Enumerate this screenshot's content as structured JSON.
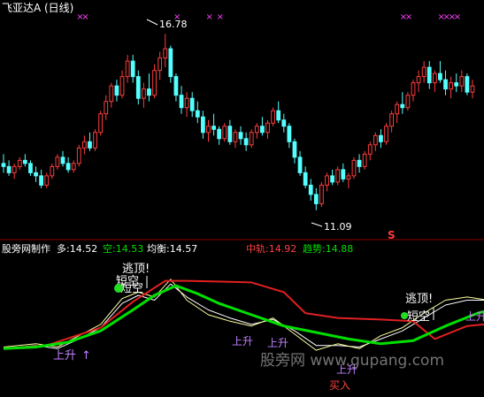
{
  "title_bar": {
    "stock_name": "飞亚达A",
    "period": "(日线)"
  },
  "colors": {
    "up": "#ff3c3c",
    "down": "#54ffff",
    "marker": "#ff40ff",
    "mid_line": "#e02020",
    "trend_line": "#00e000",
    "wave_a": "#ffffa0",
    "wave_b": "#ffffff",
    "signal_text": "#ffffff",
    "up_arrow": "#c080ff",
    "buy_label": "#ff4040"
  },
  "main_panel": {
    "high_label": "16.78",
    "low_label": "11.09",
    "s_flag": "S",
    "price_range": [
      10.4,
      17.3
    ]
  },
  "indicator_header": {
    "maker": "股旁网制作",
    "items": [
      {
        "label": "多:",
        "value": "14.52",
        "color": "#ffffff"
      },
      {
        "label": "空:",
        "value": "14.53",
        "color": "#00e000"
      },
      {
        "label": "均衡:",
        "value": "14.57",
        "color": "#ffffff"
      },
      {
        "label": "中轨:",
        "value": "14.92",
        "color": "#ff4040"
      },
      {
        "label": "趋势:",
        "value": "14.88",
        "color": "#00e000"
      }
    ]
  },
  "signals": {
    "escape_top": "逃顶!",
    "short_empty": "短空",
    "rise": "上升",
    "buy": "买入",
    "watermark": "股旁网 www.gupang.com"
  },
  "chart_data": {
    "type": "candlestick",
    "title": "飞亚达A (日线)",
    "high": 16.78,
    "low": 11.09,
    "candles": [
      [
        12.6,
        12.9,
        12.3,
        12.5
      ],
      [
        12.5,
        12.7,
        12.2,
        12.3
      ],
      [
        12.3,
        12.6,
        12.1,
        12.5
      ],
      [
        12.5,
        12.8,
        12.4,
        12.7
      ],
      [
        12.7,
        12.9,
        12.5,
        12.6
      ],
      [
        12.6,
        12.7,
        12.2,
        12.3
      ],
      [
        12.3,
        12.5,
        12.0,
        12.2
      ],
      [
        12.2,
        12.4,
        11.8,
        11.9
      ],
      [
        11.9,
        12.3,
        11.8,
        12.2
      ],
      [
        12.2,
        12.6,
        12.1,
        12.5
      ],
      [
        12.5,
        12.9,
        12.4,
        12.8
      ],
      [
        12.8,
        13.0,
        12.5,
        12.6
      ],
      [
        12.6,
        12.8,
        12.3,
        12.4
      ],
      [
        12.4,
        12.7,
        12.3,
        12.6
      ],
      [
        12.6,
        13.2,
        12.5,
        13.1
      ],
      [
        13.1,
        13.5,
        12.9,
        13.3
      ],
      [
        13.3,
        13.6,
        13.0,
        13.1
      ],
      [
        13.1,
        13.7,
        13.0,
        13.6
      ],
      [
        13.6,
        14.3,
        13.5,
        14.2
      ],
      [
        14.2,
        14.8,
        14.0,
        14.6
      ],
      [
        14.6,
        15.2,
        14.4,
        15.1
      ],
      [
        15.1,
        15.3,
        14.6,
        14.8
      ],
      [
        14.8,
        15.6,
        14.7,
        15.4
      ],
      [
        15.4,
        16.1,
        15.2,
        15.9
      ],
      [
        15.9,
        16.1,
        15.2,
        15.4
      ],
      [
        15.4,
        15.6,
        14.5,
        14.7
      ],
      [
        14.7,
        15.2,
        14.4,
        15.0
      ],
      [
        15.0,
        15.5,
        14.6,
        14.8
      ],
      [
        14.8,
        15.8,
        14.7,
        15.6
      ],
      [
        15.6,
        16.2,
        15.3,
        16.0
      ],
      [
        16.0,
        16.78,
        15.7,
        16.3
      ],
      [
        16.3,
        16.4,
        15.2,
        15.4
      ],
      [
        15.4,
        15.5,
        14.6,
        14.8
      ],
      [
        14.8,
        15.1,
        14.2,
        14.4
      ],
      [
        14.4,
        14.9,
        14.1,
        14.7
      ],
      [
        14.7,
        14.9,
        14.1,
        14.3
      ],
      [
        14.3,
        14.6,
        13.9,
        14.1
      ],
      [
        14.1,
        14.3,
        13.4,
        13.6
      ],
      [
        13.6,
        14.0,
        13.3,
        13.8
      ],
      [
        13.8,
        14.2,
        13.5,
        13.7
      ],
      [
        13.7,
        13.8,
        13.2,
        13.4
      ],
      [
        13.4,
        13.9,
        13.3,
        13.8
      ],
      [
        13.8,
        14.0,
        13.2,
        13.3
      ],
      [
        13.3,
        13.7,
        13.1,
        13.6
      ],
      [
        13.6,
        13.8,
        13.2,
        13.4
      ],
      [
        13.4,
        13.6,
        13.0,
        13.2
      ],
      [
        13.2,
        13.7,
        13.1,
        13.6
      ],
      [
        13.6,
        13.9,
        13.4,
        13.8
      ],
      [
        13.8,
        14.1,
        13.5,
        13.6
      ],
      [
        13.6,
        14.0,
        13.4,
        13.9
      ],
      [
        13.9,
        14.4,
        13.8,
        14.3
      ],
      [
        14.3,
        14.6,
        13.9,
        14.0
      ],
      [
        14.0,
        14.2,
        13.6,
        13.8
      ],
      [
        13.8,
        13.9,
        13.1,
        13.3
      ],
      [
        13.3,
        13.4,
        12.6,
        12.8
      ],
      [
        12.8,
        13.0,
        12.2,
        12.3
      ],
      [
        12.3,
        12.5,
        11.8,
        11.9
      ],
      [
        11.9,
        12.1,
        11.4,
        11.6
      ],
      [
        11.6,
        11.8,
        11.09,
        11.3
      ],
      [
        11.3,
        12.0,
        11.2,
        11.9
      ],
      [
        11.9,
        12.3,
        11.7,
        12.2
      ],
      [
        12.2,
        12.4,
        11.9,
        12.0
      ],
      [
        12.0,
        12.5,
        11.9,
        12.4
      ],
      [
        12.4,
        12.6,
        12.0,
        12.1
      ],
      [
        12.1,
        12.3,
        11.8,
        12.2
      ],
      [
        12.2,
        12.8,
        12.1,
        12.7
      ],
      [
        12.7,
        12.9,
        12.3,
        12.5
      ],
      [
        12.5,
        13.0,
        12.4,
        12.9
      ],
      [
        12.9,
        13.3,
        12.7,
        13.2
      ],
      [
        13.2,
        13.6,
        13.0,
        13.5
      ],
      [
        13.5,
        13.7,
        13.1,
        13.3
      ],
      [
        13.3,
        13.9,
        13.2,
        13.8
      ],
      [
        13.8,
        14.3,
        13.6,
        14.2
      ],
      [
        14.2,
        14.6,
        13.9,
        14.5
      ],
      [
        14.5,
        14.9,
        14.2,
        14.4
      ],
      [
        14.4,
        14.9,
        14.3,
        14.8
      ],
      [
        14.8,
        15.3,
        14.6,
        15.2
      ],
      [
        15.2,
        15.6,
        14.9,
        15.4
      ],
      [
        15.4,
        15.9,
        15.2,
        15.7
      ],
      [
        15.7,
        15.9,
        15.0,
        15.2
      ],
      [
        15.2,
        15.6,
        14.9,
        15.5
      ],
      [
        15.5,
        15.9,
        15.2,
        15.3
      ],
      [
        15.3,
        15.6,
        14.8,
        15.0
      ],
      [
        15.0,
        15.4,
        14.7,
        15.2
      ],
      [
        15.2,
        15.5,
        14.9,
        15.1
      ],
      [
        15.1,
        15.6,
        14.9,
        15.4
      ],
      [
        15.4,
        15.5,
        14.8,
        14.9
      ],
      [
        14.9,
        15.3,
        14.7,
        15.1
      ]
    ],
    "marker_x": [
      14,
      15,
      32,
      38,
      40,
      74,
      75,
      81,
      82,
      83,
      84,
      93,
      94
    ],
    "indicator": {
      "range": [
        9.5,
        17.6
      ],
      "mid_line": [
        [
          0,
          12.0
        ],
        [
          8,
          12.2
        ],
        [
          18,
          13.3
        ],
        [
          24,
          14.9
        ],
        [
          30,
          16.2
        ],
        [
          34,
          16.2
        ],
        [
          46,
          16.1
        ],
        [
          52,
          15.5
        ],
        [
          56,
          14.2
        ],
        [
          62,
          13.9
        ],
        [
          70,
          13.8
        ],
        [
          76,
          13.7
        ],
        [
          80,
          12.6
        ],
        [
          86,
          13.4
        ],
        [
          92,
          13.6
        ],
        [
          97,
          14.0
        ]
      ],
      "trend_line": [
        [
          0,
          12.0
        ],
        [
          6,
          12.1
        ],
        [
          12,
          12.4
        ],
        [
          18,
          13.1
        ],
        [
          24,
          14.4
        ],
        [
          28,
          15.3
        ],
        [
          32,
          15.9
        ],
        [
          36,
          15.4
        ],
        [
          40,
          14.8
        ],
        [
          46,
          14.1
        ],
        [
          52,
          13.4
        ],
        [
          58,
          13.0
        ],
        [
          64,
          12.6
        ],
        [
          70,
          12.3
        ],
        [
          76,
          12.5
        ],
        [
          82,
          13.4
        ],
        [
          88,
          14.2
        ],
        [
          93,
          14.6
        ],
        [
          97,
          14.7
        ]
      ],
      "wave_a": [
        [
          0,
          12.1
        ],
        [
          6,
          12.3
        ],
        [
          10,
          12.1
        ],
        [
          14,
          12.8
        ],
        [
          18,
          13.5
        ],
        [
          22,
          15.1
        ],
        [
          25,
          15.5
        ],
        [
          28,
          15.2
        ],
        [
          31,
          16.3
        ],
        [
          34,
          15.0
        ],
        [
          38,
          14.1
        ],
        [
          42,
          13.7
        ],
        [
          46,
          13.4
        ],
        [
          50,
          13.9
        ],
        [
          54,
          12.9
        ],
        [
          58,
          11.9
        ],
        [
          62,
          12.3
        ],
        [
          66,
          12.0
        ],
        [
          70,
          12.8
        ],
        [
          74,
          13.3
        ],
        [
          78,
          14.2
        ],
        [
          82,
          15.0
        ],
        [
          86,
          15.2
        ],
        [
          90,
          15.0
        ],
        [
          94,
          15.3
        ],
        [
          97,
          15.2
        ]
      ],
      "wave_b": [
        [
          0,
          12.0
        ],
        [
          6,
          12.2
        ],
        [
          10,
          12.0
        ],
        [
          14,
          12.6
        ],
        [
          18,
          13.3
        ],
        [
          22,
          14.8
        ],
        [
          25,
          15.3
        ],
        [
          28,
          15.0
        ],
        [
          31,
          16.0
        ],
        [
          34,
          15.2
        ],
        [
          38,
          14.4
        ],
        [
          42,
          13.9
        ],
        [
          46,
          13.5
        ],
        [
          50,
          13.8
        ],
        [
          54,
          13.1
        ],
        [
          58,
          12.2
        ],
        [
          62,
          12.2
        ],
        [
          66,
          12.1
        ],
        [
          70,
          12.6
        ],
        [
          74,
          13.1
        ],
        [
          78,
          13.9
        ],
        [
          82,
          14.7
        ],
        [
          86,
          15.0
        ],
        [
          90,
          15.0
        ],
        [
          94,
          15.2
        ],
        [
          97,
          15.2
        ]
      ]
    }
  }
}
